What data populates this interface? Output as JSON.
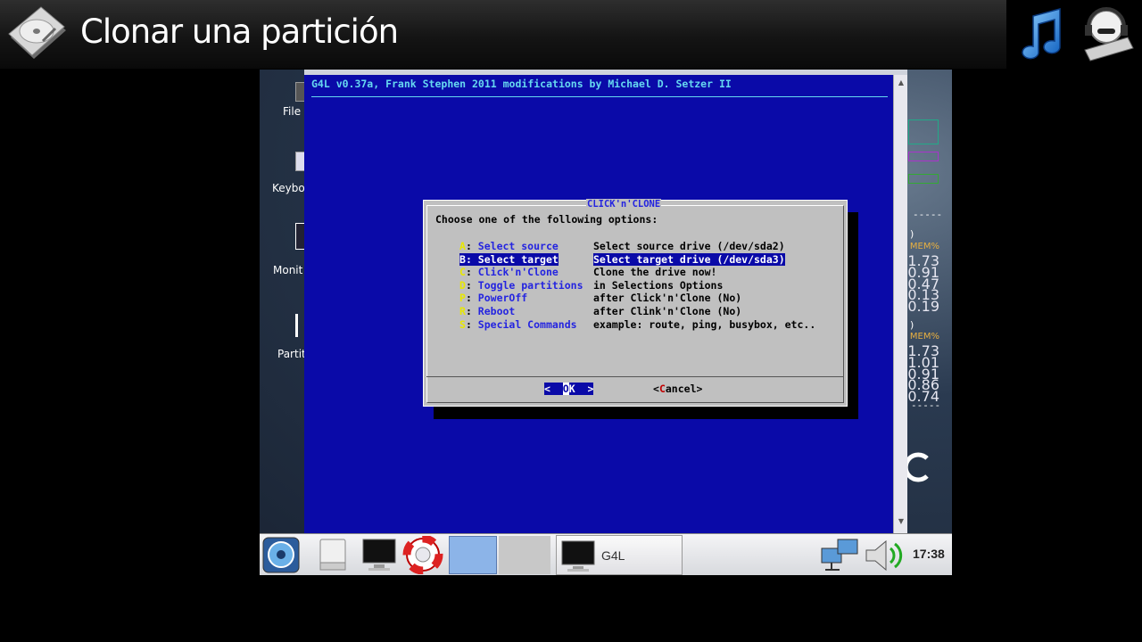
{
  "video_title": "Clonar una partición",
  "desktop": {
    "icons": [
      {
        "label": "File M"
      },
      {
        "label": "Keybo"
      },
      {
        "label": "Monit"
      },
      {
        "label": "Partit"
      }
    ],
    "conky": {
      "block1": {
        "header": "MEM%",
        "values": [
          "1.73",
          "0.91",
          "0.47",
          "0.13",
          "0.19"
        ]
      },
      "block2": {
        "header": "MEM%",
        "values": [
          "1.73",
          "1.01",
          "0.91",
          "0.86",
          "0.74"
        ]
      },
      "dashes": "-----",
      "paren": ")"
    }
  },
  "terminal": {
    "header": "G4L v0.37a, Frank Stephen 2011 modifications by Michael D. Setzer II"
  },
  "dialog": {
    "title": "CLICK'n'CLONE",
    "prompt": "Choose one of the following options:",
    "options": [
      {
        "key": "A",
        "label": "Select source",
        "desc": "Select source drive (/dev/sda2)"
      },
      {
        "key": "B",
        "label": "Select target",
        "desc": "Select target drive (/dev/sda3)"
      },
      {
        "key": "C",
        "label": "Click'n'Clone",
        "desc": "Clone the drive now!"
      },
      {
        "key": "D",
        "label": "Toggle partitions",
        "desc": "in Selections Options"
      },
      {
        "key": "P",
        "label": "PowerOff",
        "desc": "after Click'n'Clone (No)"
      },
      {
        "key": "R",
        "label": "Reboot",
        "desc": "after Clink'n'Clone (No)"
      },
      {
        "key": "S",
        "label": "Special Commands",
        "desc": "example: route, ping, busybox, etc.."
      }
    ],
    "selected_index": 1,
    "ok_pre": "<  ",
    "ok_hot": "O",
    "ok_post": "K  >",
    "cancel_pre": "<",
    "cancel_hot": "C",
    "cancel_post": "ancel>"
  },
  "taskbar": {
    "g4l_label": "G4L",
    "clock": "17:38"
  },
  "colors": {
    "terminal_bg": "#0a0aa8",
    "dialog_bg": "#c0c0c0",
    "hotkey": "#e8e800",
    "option_label": "#2424e0"
  }
}
